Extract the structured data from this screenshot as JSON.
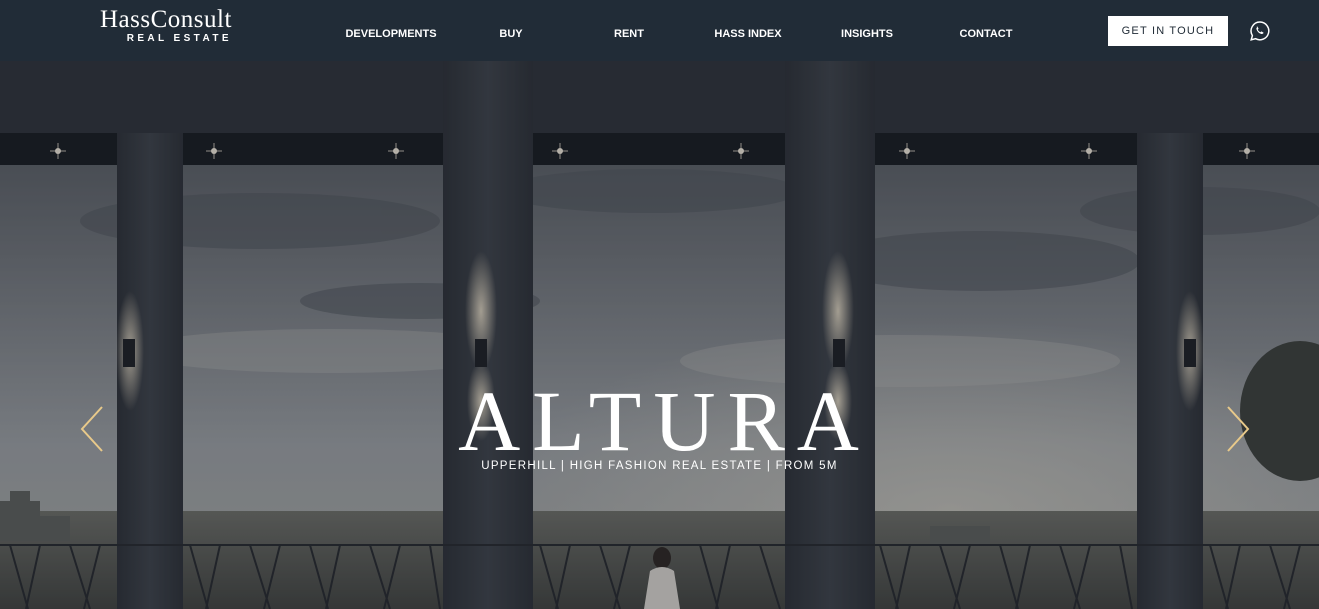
{
  "header": {
    "logo_main": "HassConsult",
    "logo_sub": "REAL ESTATE",
    "nav": [
      {
        "label": "DEVELOPMENTS"
      },
      {
        "label": "BUY"
      },
      {
        "label": "RENT"
      },
      {
        "label": "HASS INDEX"
      },
      {
        "label": "INSIGHTS"
      },
      {
        "label": "CONTACT"
      }
    ],
    "cta_label": "GET IN TOUCH",
    "whatsapp_icon": "whatsapp-icon"
  },
  "hero": {
    "title": "ALTURA",
    "subtitle": "UPPERHILL | HIGH FASHION REAL ESTATE | FROM 5M",
    "prev_icon": "chevron-left-icon",
    "next_icon": "chevron-right-icon",
    "arrow_color": "#e8c98a"
  },
  "colors": {
    "header_bg": "#212c37",
    "cta_bg": "#ffffff",
    "cta_text": "#1f2a35"
  }
}
